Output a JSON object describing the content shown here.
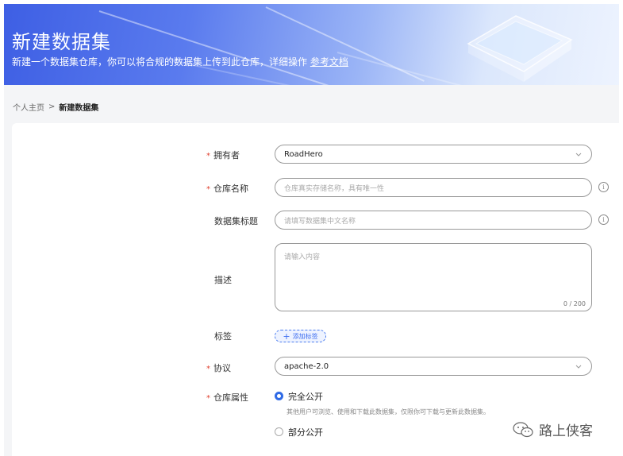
{
  "banner": {
    "title": "新建数据集",
    "description": "新建一个数据集仓库，你可以将合规的数据集上传到此仓库，详细操作",
    "doc_link": "参考文档"
  },
  "breadcrumb": {
    "home": "个人主页",
    "separator": ">",
    "current": "新建数据集"
  },
  "form": {
    "owner": {
      "label": "拥有者",
      "required_mark": "*",
      "value": "RoadHero"
    },
    "repo_name": {
      "label": "仓库名称",
      "required_mark": "*",
      "placeholder": "仓库真实存储名称，具有唯一性",
      "info_icon": "i"
    },
    "dataset_title": {
      "label": "数据集标题",
      "placeholder": "请填写数据集中文名称",
      "info_icon": "i"
    },
    "description": {
      "label": "描述",
      "placeholder": "请输入内容",
      "counter": "0 / 200"
    },
    "tags": {
      "label": "标签",
      "add_button": "添加标签",
      "plus": "+"
    },
    "license": {
      "label": "协议",
      "required_mark": "*",
      "value": "apache-2.0"
    },
    "visibility": {
      "label": "仓库属性",
      "required_mark": "*",
      "options": [
        {
          "label": "完全公开",
          "selected": true,
          "hint": "其他用户可浏览、使用和下载此数据集，仅限你可下载与更新此数据集。"
        },
        {
          "label": "部分公开",
          "selected": false
        }
      ]
    }
  },
  "watermark": {
    "text": "路上侠客",
    "icon": "wechat-icon"
  },
  "colors": {
    "accent": "#2f6ae6",
    "required": "#e0412f",
    "banner_start": "#3e5fe4"
  }
}
